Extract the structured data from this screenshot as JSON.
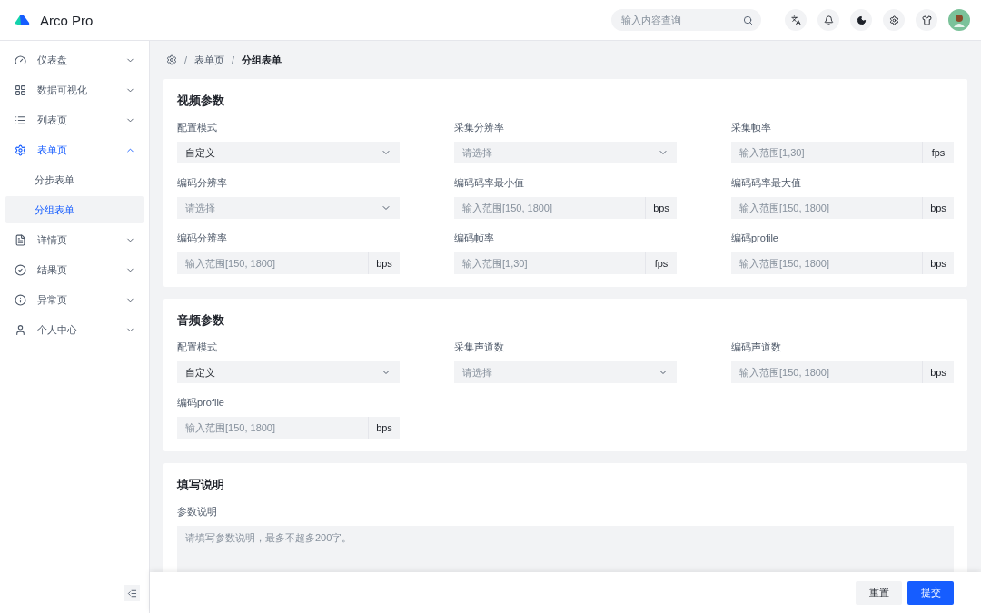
{
  "header": {
    "logo_text": "Arco Pro",
    "search": {
      "placeholder": "输入内容查询"
    }
  },
  "sidebar": {
    "items": [
      {
        "label": "仪表盘",
        "expanded": false,
        "selected": false
      },
      {
        "label": "数据可视化",
        "expanded": false,
        "selected": false
      },
      {
        "label": "列表页",
        "expanded": false,
        "selected": false
      },
      {
        "label": "表单页",
        "expanded": true,
        "selected": true,
        "children": [
          {
            "label": "分步表单",
            "selected": false
          },
          {
            "label": "分组表单",
            "selected": true
          }
        ]
      },
      {
        "label": "详情页",
        "expanded": false,
        "selected": false
      },
      {
        "label": "结果页",
        "expanded": false,
        "selected": false
      },
      {
        "label": "异常页",
        "expanded": false,
        "selected": false
      },
      {
        "label": "个人中心",
        "expanded": false,
        "selected": false
      }
    ]
  },
  "breadcrumb": {
    "separator": "/",
    "items": [
      "表单页",
      "分组表单"
    ]
  },
  "sections": [
    {
      "title": "视频参数",
      "fields": [
        {
          "label": "配置模式",
          "kind": "select",
          "value": "自定义"
        },
        {
          "label": "采集分辨率",
          "kind": "select",
          "placeholder": "请选择"
        },
        {
          "label": "采集帧率",
          "kind": "input",
          "placeholder": "输入范围[1,30]",
          "suffix": "fps"
        },
        {
          "label": "编码分辨率",
          "kind": "select",
          "placeholder": "请选择"
        },
        {
          "label": "编码码率最小值",
          "kind": "input",
          "placeholder": "输入范围[150, 1800]",
          "suffix": "bps"
        },
        {
          "label": "编码码率最大值",
          "kind": "input",
          "placeholder": "输入范围[150, 1800]",
          "suffix": "bps"
        },
        {
          "label": "编码分辨率",
          "kind": "input",
          "placeholder": "输入范围[150, 1800]",
          "suffix": "bps"
        },
        {
          "label": "编码帧率",
          "kind": "input",
          "placeholder": "输入范围[1,30]",
          "suffix": "fps"
        },
        {
          "label": "编码profile",
          "kind": "input",
          "placeholder": "输入范围[150, 1800]",
          "suffix": "bps"
        }
      ]
    },
    {
      "title": "音频参数",
      "fields": [
        {
          "label": "配置模式",
          "kind": "select",
          "value": "自定义"
        },
        {
          "label": "采集声道数",
          "kind": "select",
          "placeholder": "请选择"
        },
        {
          "label": "编码声道数",
          "kind": "input",
          "placeholder": "输入范围[150, 1800]",
          "suffix": "bps"
        },
        {
          "label": "编码profile",
          "kind": "input",
          "placeholder": "输入范围[150, 1800]",
          "suffix": "bps"
        }
      ]
    },
    {
      "title": "填写说明",
      "fields": [
        {
          "label": "参数说明",
          "kind": "textarea",
          "placeholder": "请填写参数说明，最多不超多200字。"
        }
      ]
    }
  ],
  "footer": {
    "buttons": [
      {
        "label": "重置",
        "kind": "secondary"
      },
      {
        "label": "提交",
        "kind": "primary"
      }
    ]
  }
}
